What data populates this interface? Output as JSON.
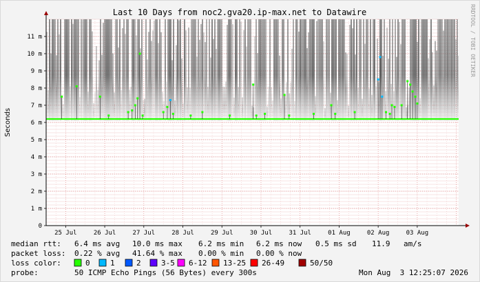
{
  "chart_data": {
    "type": "scatter",
    "title": "Last 10 Days from noc2.gva20.ip-max.net to Datawire",
    "ylabel": "Seconds",
    "side_label": "RRDTOOL / TOBI OETIKER",
    "ylim": [
      0,
      0.012
    ],
    "y_ticks": [
      {
        "value": 0,
        "label": "0"
      },
      {
        "value": 0.001,
        "label": "1 m"
      },
      {
        "value": 0.002,
        "label": "2 m"
      },
      {
        "value": 0.003,
        "label": "3 m"
      },
      {
        "value": 0.004,
        "label": "4 m"
      },
      {
        "value": 0.005,
        "label": "5 m"
      },
      {
        "value": 0.006,
        "label": "6 m"
      },
      {
        "value": 0.007,
        "label": "7 m"
      },
      {
        "value": 0.008,
        "label": "8 m"
      },
      {
        "value": 0.009,
        "label": "9 m"
      },
      {
        "value": 0.01,
        "label": "10 m"
      },
      {
        "value": 0.011,
        "label": "11 m"
      }
    ],
    "x_day_range": [
      -0.5,
      10.06
    ],
    "x_ticks": [
      {
        "day": 0,
        "label": "25 Jul"
      },
      {
        "day": 1,
        "label": "26 Jul"
      },
      {
        "day": 2,
        "label": "27 Jul"
      },
      {
        "day": 3,
        "label": "28 Jul"
      },
      {
        "day": 4,
        "label": "29 Jul"
      },
      {
        "day": 5,
        "label": "30 Jul"
      },
      {
        "day": 6,
        "label": "31 Jul"
      },
      {
        "day": 7,
        "label": "01 Aug"
      },
      {
        "day": 8,
        "label": "02 Aug"
      },
      {
        "day": 9,
        "label": "03 Aug"
      }
    ],
    "grid": true,
    "baseline_rtt": 0.0062,
    "spikes": [
      {
        "day": -0.1,
        "rtt": 0.0075,
        "loss": 0
      },
      {
        "day": 0.28,
        "rtt": 0.0081,
        "loss": 0
      },
      {
        "day": 0.88,
        "rtt": 0.0075,
        "loss": 0
      },
      {
        "day": 1.1,
        "rtt": 0.0064,
        "loss": 0
      },
      {
        "day": 1.6,
        "rtt": 0.0066,
        "loss": 0
      },
      {
        "day": 1.7,
        "rtt": 0.0067,
        "loss": 0
      },
      {
        "day": 1.78,
        "rtt": 0.007,
        "loss": 0
      },
      {
        "day": 1.84,
        "rtt": 0.0074,
        "loss": 0
      },
      {
        "day": 1.9,
        "rtt": 0.01,
        "loss": 0
      },
      {
        "day": 1.97,
        "rtt": 0.0064,
        "loss": 0
      },
      {
        "day": 2.5,
        "rtt": 0.0066,
        "loss": 0
      },
      {
        "day": 2.6,
        "rtt": 0.0069,
        "loss": 0
      },
      {
        "day": 2.68,
        "rtt": 0.0073,
        "loss": 1
      },
      {
        "day": 2.75,
        "rtt": 0.0065,
        "loss": 0
      },
      {
        "day": 3.2,
        "rtt": 0.0064,
        "loss": 0
      },
      {
        "day": 3.5,
        "rtt": 0.0066,
        "loss": 0
      },
      {
        "day": 4.2,
        "rtt": 0.0064,
        "loss": 0
      },
      {
        "day": 4.8,
        "rtt": 0.0082,
        "loss": 0
      },
      {
        "day": 4.88,
        "rtt": 0.0064,
        "loss": 0
      },
      {
        "day": 5.1,
        "rtt": 0.0065,
        "loss": 0
      },
      {
        "day": 5.6,
        "rtt": 0.0076,
        "loss": 0
      },
      {
        "day": 5.72,
        "rtt": 0.0064,
        "loss": 0
      },
      {
        "day": 6.35,
        "rtt": 0.0065,
        "loss": 0
      },
      {
        "day": 6.8,
        "rtt": 0.007,
        "loss": 0
      },
      {
        "day": 6.9,
        "rtt": 0.0065,
        "loss": 0
      },
      {
        "day": 7.4,
        "rtt": 0.0066,
        "loss": 0
      },
      {
        "day": 8.0,
        "rtt": 0.0085,
        "loss": 1
      },
      {
        "day": 8.05,
        "rtt": 0.0098,
        "loss": 1
      },
      {
        "day": 8.1,
        "rtt": 0.0075,
        "loss": 1
      },
      {
        "day": 8.2,
        "rtt": 0.0066,
        "loss": 0
      },
      {
        "day": 8.3,
        "rtt": 0.0065,
        "loss": 0
      },
      {
        "day": 8.35,
        "rtt": 0.007,
        "loss": 0
      },
      {
        "day": 8.42,
        "rtt": 0.0069,
        "loss": 0
      },
      {
        "day": 8.6,
        "rtt": 0.007,
        "loss": 0
      },
      {
        "day": 8.75,
        "rtt": 0.0084,
        "loss": 0
      },
      {
        "day": 8.82,
        "rtt": 0.0082,
        "loss": 0
      },
      {
        "day": 8.88,
        "rtt": 0.0078,
        "loss": 0
      },
      {
        "day": 8.95,
        "rtt": 0.0075,
        "loss": 0
      },
      {
        "day": 9.0,
        "rtt": 0.0071,
        "loss": 0
      }
    ],
    "stats": {
      "median_rtt": {
        "label": "median rtt:",
        "avg": "6.4 ms avg",
        "max": "10.0 ms max",
        "min": "6.2 ms min",
        "now": "6.2 ms now",
        "sd": "0.5 ms sd",
        "am": "11.9",
        "am_unit": "am/s"
      },
      "packet_loss": {
        "label": "packet loss:",
        "avg": "0.22 % avg",
        "max": "41.64 % max",
        "min": "0.00 % min",
        "now": "0.00 % now"
      }
    },
    "loss_legend": {
      "label": "loss color:",
      "items": [
        {
          "label": "0",
          "color": "#26ff00"
        },
        {
          "label": "1",
          "color": "#00b8ff"
        },
        {
          "label": "2",
          "color": "#0059ff"
        },
        {
          "label": "3-5",
          "color": "#5e00ff"
        },
        {
          "label": "6-12",
          "color": "#ff00ff"
        },
        {
          "label": "13-25",
          "color": "#ff5500"
        },
        {
          "label": "26-49",
          "color": "#ff0000"
        },
        {
          "label": "50/50",
          "color": "#a10000"
        }
      ]
    },
    "probe": {
      "label": "probe:",
      "text": "50 ICMP Echo Pings (56 Bytes) every 300s"
    },
    "timestamp": "Mon Aug  3 12:25:07 2026"
  }
}
